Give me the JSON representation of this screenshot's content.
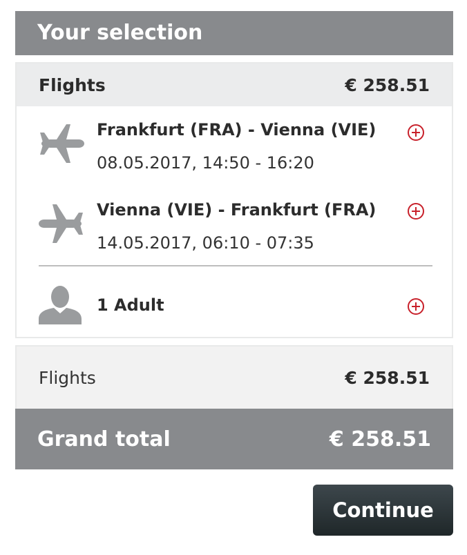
{
  "header": {
    "title": "Your selection"
  },
  "flights_card": {
    "title": "Flights",
    "price": "€ 258.51",
    "segments": [
      {
        "route": "Frankfurt (FRA) - Vienna (VIE)",
        "datetime": "08.05.2017, 14:50 - 16:20",
        "icon": "plane-outbound-icon"
      },
      {
        "route": "Vienna (VIE) - Frankfurt (FRA)",
        "datetime": "14.05.2017, 06:10 - 07:35",
        "icon": "plane-return-icon"
      }
    ],
    "passengers": {
      "label": "1 Adult",
      "icon": "person-icon"
    }
  },
  "summary": {
    "label": "Flights",
    "price": "€ 258.51"
  },
  "grand_total": {
    "label": "Grand total",
    "price": "€ 258.51"
  },
  "actions": {
    "continue_label": "Continue"
  },
  "colors": {
    "header_bg": "#888a8d",
    "accent_red": "#c8202a",
    "button_dark": "#2a3235",
    "icon_gray": "#9a9c9e"
  }
}
